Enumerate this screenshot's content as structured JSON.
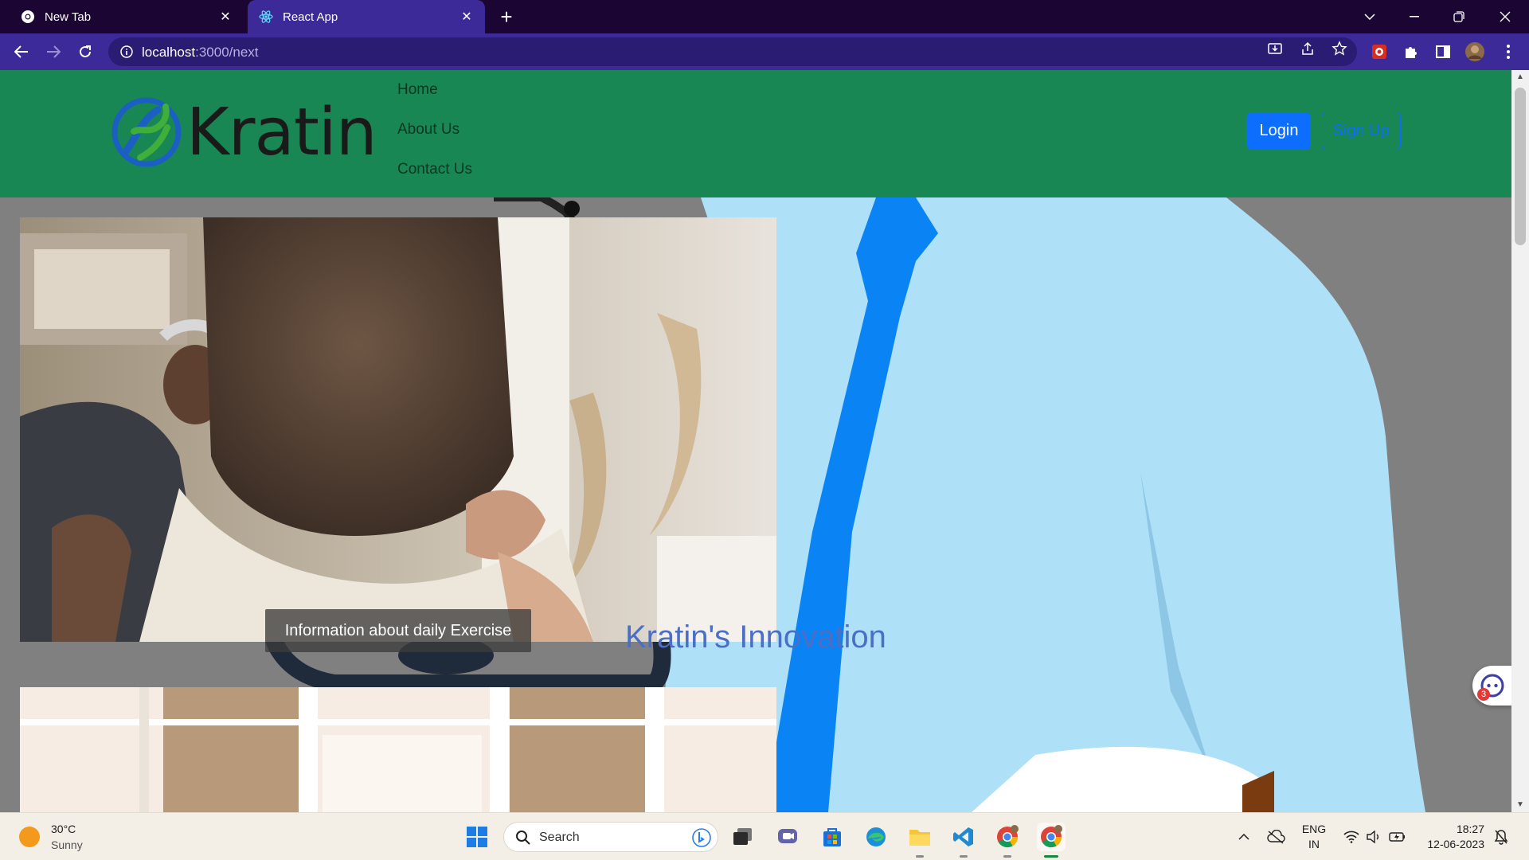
{
  "browser": {
    "tabs": [
      {
        "title": "New Tab",
        "active": false,
        "icon": "chrome-icon"
      },
      {
        "title": "React App",
        "active": true,
        "icon": "react-icon"
      }
    ],
    "url_host": "localhost",
    "url_path": ":3000/next"
  },
  "site": {
    "brand": "Kratin",
    "nav": [
      "Home",
      "About Us",
      "Contact Us"
    ],
    "login_label": "Login",
    "signup_label": "Sign Up",
    "hero_caption": "Information about daily Exercise",
    "hero_title": "Kratin's Innovation",
    "assistant_badge": "3"
  },
  "taskbar": {
    "temperature": "30°C",
    "condition": "Sunny",
    "search_label": "Search",
    "lang_line1": "ENG",
    "lang_line2": "IN",
    "time": "18:27",
    "date": "12-06-2023"
  },
  "colors": {
    "navbar": "#198754",
    "primary": "#0d6efd",
    "browser_frame": "#3c2a98",
    "shirt": "#aee0f8",
    "tie": "#0a84f5"
  }
}
